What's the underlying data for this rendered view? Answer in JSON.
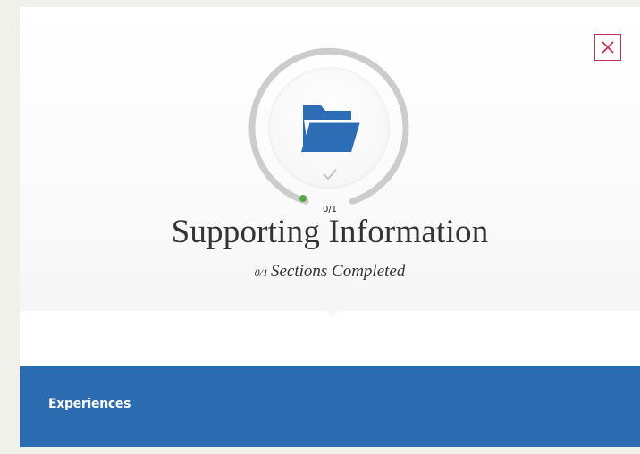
{
  "dialog": {
    "close_label": "Close",
    "progress": {
      "completed": 0,
      "total": 1,
      "fraction": 0.0,
      "count_text": "0/1"
    },
    "title": "Supporting Information",
    "subtitle_count": "0/1",
    "subtitle_text": "Sections Completed"
  },
  "section": {
    "label": "Experiences"
  },
  "colors": {
    "accent_blue": "#2b6cb0",
    "folder_blue": "#2d6db5",
    "close_red": "#c8304d",
    "progress_green": "#56a845",
    "ring_gray": "#cccccc"
  },
  "icons": {
    "close": "close-icon",
    "folder": "folder-open-icon",
    "check": "check-icon"
  }
}
